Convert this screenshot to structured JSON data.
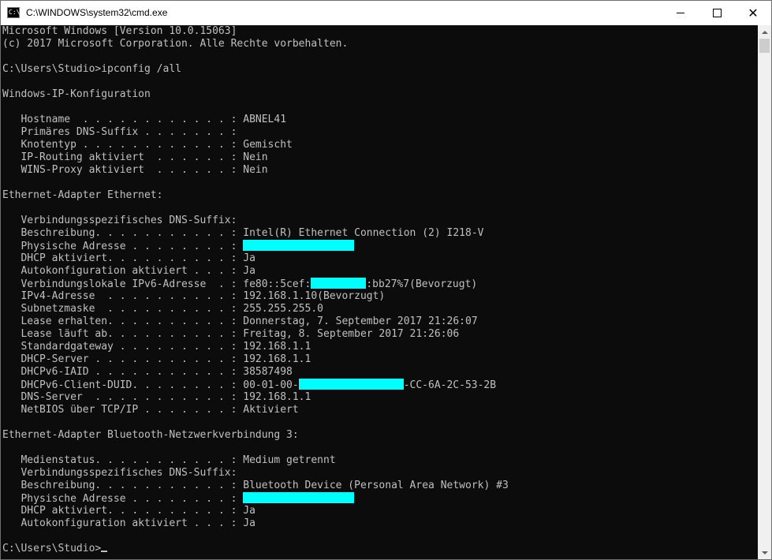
{
  "window": {
    "title": "C:\\WINDOWS\\system32\\cmd.exe",
    "icon_label": "C:\\",
    "icon": "cmd-icon",
    "controls": [
      "minimize-icon",
      "maximize-icon",
      "close-icon"
    ]
  },
  "colors": {
    "console_bg": "#0c0c0c",
    "console_fg": "#c0c0c0",
    "redaction": "#00ffff"
  },
  "console": {
    "lines": [
      {
        "text": "Microsoft Windows [Version 10.0.15063]"
      },
      {
        "text": "(c) 2017 Microsoft Corporation. Alle Rechte vorbehalten."
      },
      {
        "text": ""
      },
      {
        "text": "C:\\Users\\Studio>ipconfig /all"
      },
      {
        "text": ""
      },
      {
        "text": "Windows-IP-Konfiguration"
      },
      {
        "text": ""
      },
      {
        "text": "   Hostname  . . . . . . . . . . . . : ABNEL41"
      },
      {
        "text": "   Primäres DNS-Suffix . . . . . . . :"
      },
      {
        "text": "   Knotentyp . . . . . . . . . . . . : Gemischt"
      },
      {
        "text": "   IP-Routing aktiviert  . . . . . . : Nein"
      },
      {
        "text": "   WINS-Proxy aktiviert  . . . . . . : Nein"
      },
      {
        "text": ""
      },
      {
        "text": "Ethernet-Adapter Ethernet:"
      },
      {
        "text": ""
      },
      {
        "text": "   Verbindungsspezifisches DNS-Suffix:"
      },
      {
        "text": "   Beschreibung. . . . . . . . . . . : Intel(R) Ethernet Connection (2) I218-V"
      },
      {
        "text": "   Physische Adresse . . . . . . . . : ",
        "redact": 18
      },
      {
        "text": "   DHCP aktiviert. . . . . . . . . . : Ja"
      },
      {
        "text": "   Autokonfiguration aktiviert . . . : Ja"
      },
      {
        "text": "   Verbindungslokale IPv6-Adresse  . : fe80::5cef:",
        "redact": 9,
        "after": ":bb27%7(Bevorzugt)"
      },
      {
        "text": "   IPv4-Adresse  . . . . . . . . . . : 192.168.1.10(Bevorzugt)"
      },
      {
        "text": "   Subnetzmaske  . . . . . . . . . . : 255.255.255.0"
      },
      {
        "text": "   Lease erhalten. . . . . . . . . . : Donnerstag, 7. September 2017 21:26:07"
      },
      {
        "text": "   Lease läuft ab. . . . . . . . . . : Freitag, 8. September 2017 21:26:06"
      },
      {
        "text": "   Standardgateway . . . . . . . . . : 192.168.1.1"
      },
      {
        "text": "   DHCP-Server . . . . . . . . . . . : 192.168.1.1"
      },
      {
        "text": "   DHCPv6-IAID . . . . . . . . . . . : 38587498"
      },
      {
        "text": "   DHCPv6-Client-DUID. . . . . . . . : 00-01-00-",
        "redact": 17,
        "after": "-CC-6A-2C-53-2B"
      },
      {
        "text": "   DNS-Server  . . . . . . . . . . . : 192.168.1.1"
      },
      {
        "text": "   NetBIOS über TCP/IP . . . . . . . : Aktiviert"
      },
      {
        "text": ""
      },
      {
        "text": "Ethernet-Adapter Bluetooth-Netzwerkverbindung 3:"
      },
      {
        "text": ""
      },
      {
        "text": "   Medienstatus. . . . . . . . . . . : Medium getrennt"
      },
      {
        "text": "   Verbindungsspezifisches DNS-Suffix:"
      },
      {
        "text": "   Beschreibung. . . . . . . . . . . : Bluetooth Device (Personal Area Network) #3"
      },
      {
        "text": "   Physische Adresse . . . . . . . . : ",
        "redact": 18
      },
      {
        "text": "   DHCP aktiviert. . . . . . . . . . : Ja"
      },
      {
        "text": "   Autokonfiguration aktiviert . . . : Ja"
      },
      {
        "text": ""
      },
      {
        "text": "C:\\Users\\Studio>",
        "cursor": true
      }
    ]
  }
}
